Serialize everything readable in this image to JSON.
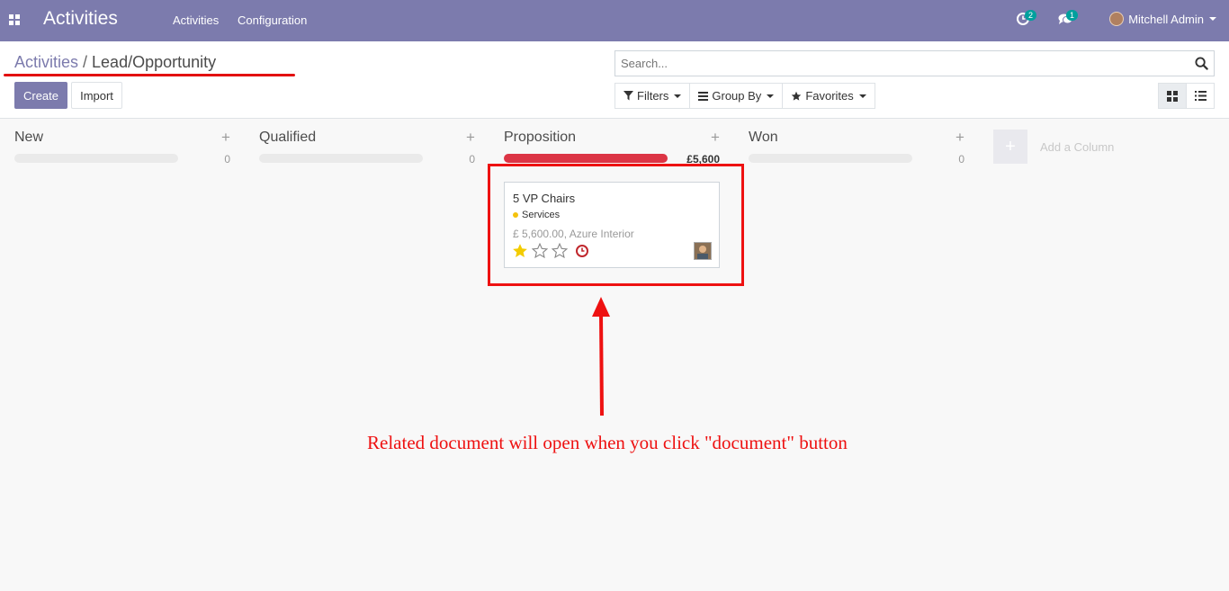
{
  "app": {
    "title": "Activities",
    "menu": [
      "Activities",
      "Configuration"
    ],
    "activity_badge": "2",
    "message_badge": "1",
    "user_name": "Mitchell Admin"
  },
  "breadcrumb": {
    "parent": "Activities",
    "separator": "/",
    "current": "Lead/Opportunity"
  },
  "buttons": {
    "create": "Create",
    "import": "Import"
  },
  "search": {
    "placeholder": "Search..."
  },
  "filters": {
    "filters_label": "Filters",
    "group_by_label": "Group By",
    "favorites_label": "Favorites"
  },
  "view": {
    "active": "kanban",
    "options": [
      "kanban",
      "list"
    ]
  },
  "columns": [
    {
      "title": "New",
      "total": "0",
      "progress_fraction": 0
    },
    {
      "title": "Qualified",
      "total": "0",
      "progress_fraction": 0
    },
    {
      "title": "Proposition",
      "total": "£5,600",
      "progress_fraction": 1,
      "progress_color": "#dc3545"
    },
    {
      "title": "Won",
      "total": "0",
      "progress_fraction": 0
    }
  ],
  "add_column": {
    "plus": "+",
    "label": "Add a Column"
  },
  "card": {
    "title": "5 VP Chairs",
    "tag": "Services",
    "tag_color": "#f4c20d",
    "amount_text": "£ 5,600.00, Azure Interior",
    "priority_stars": 1,
    "max_stars": 3,
    "activity_icon": "clock-icon",
    "activity_color": "#c0272d"
  },
  "annotation": {
    "text": "Related document will open when you click \"document\" button",
    "color": "#ee1111"
  },
  "colors": {
    "navbar": "#7c7bad",
    "primary_button": "#7c7bad",
    "badge": "#00a09d"
  }
}
